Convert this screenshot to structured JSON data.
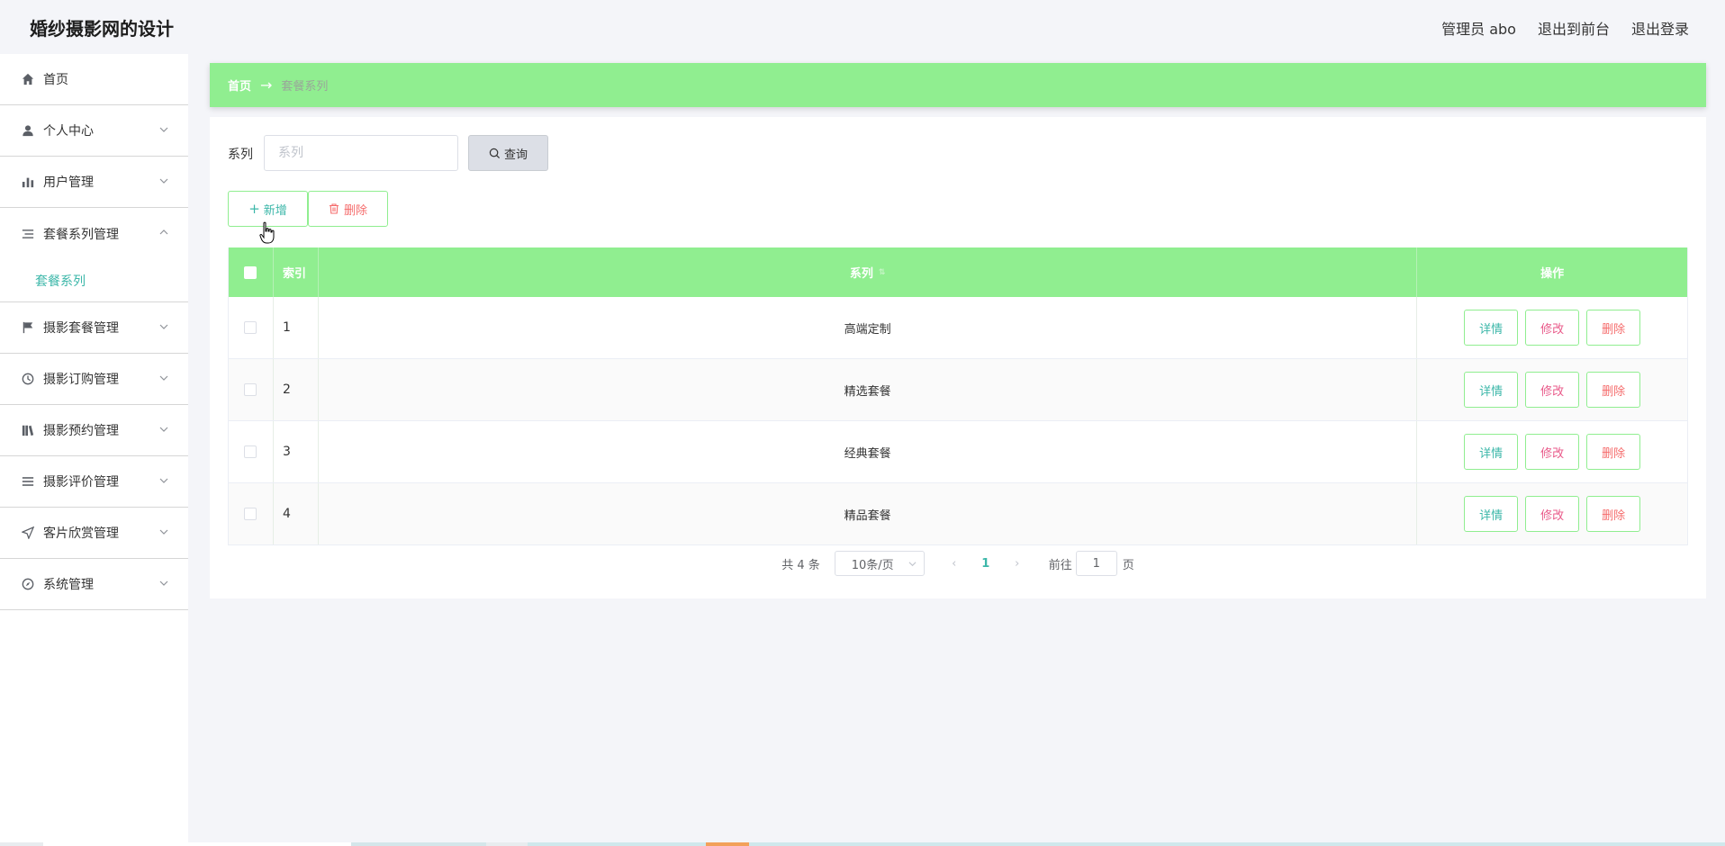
{
  "header": {
    "title": "婚纱摄影网的设计",
    "admin": "管理员 abo",
    "to_front": "退出到前台",
    "logout": "退出登录"
  },
  "sidebar": {
    "items": [
      {
        "label": "首页",
        "icon": "home-icon"
      },
      {
        "label": "个人中心",
        "icon": "user-icon"
      },
      {
        "label": "用户管理",
        "icon": "bar-chart-icon"
      },
      {
        "label": "套餐系列管理",
        "icon": "list-icon",
        "expanded": true,
        "sub": [
          "套餐系列"
        ]
      },
      {
        "label": "摄影套餐管理",
        "icon": "flag-icon"
      },
      {
        "label": "摄影订购管理",
        "icon": "clock-icon"
      },
      {
        "label": "摄影预约管理",
        "icon": "books-icon"
      },
      {
        "label": "摄影评价管理",
        "icon": "menu-icon"
      },
      {
        "label": "客片欣赏管理",
        "icon": "send-icon"
      },
      {
        "label": "系统管理",
        "icon": "compass-icon"
      }
    ]
  },
  "breadcrumb": {
    "home": "首页",
    "arrow": "→",
    "current": "套餐系列"
  },
  "search": {
    "label": "系列",
    "placeholder": "系列",
    "query_label": "查询"
  },
  "actions": {
    "add_label": "新增",
    "delete_label": "删除"
  },
  "table": {
    "headers": {
      "index": "索引",
      "series": "系列",
      "ops": "操作"
    },
    "rows": [
      {
        "index": "1",
        "series": "高端定制"
      },
      {
        "index": "2",
        "series": "精选套餐"
      },
      {
        "index": "3",
        "series": "经典套餐"
      },
      {
        "index": "4",
        "series": "精品套餐"
      }
    ],
    "op_labels": {
      "detail": "详情",
      "edit": "修改",
      "delete": "删除"
    }
  },
  "pagination": {
    "total": "共 4 条",
    "page_size": "10条/页",
    "current_page": "1",
    "goto_label": "前往",
    "goto_value": "1",
    "goto_suffix": "页"
  },
  "colors": {
    "accent_green": "#90ee90",
    "teal": "#3cb7a9",
    "danger": "#f56c6c"
  }
}
